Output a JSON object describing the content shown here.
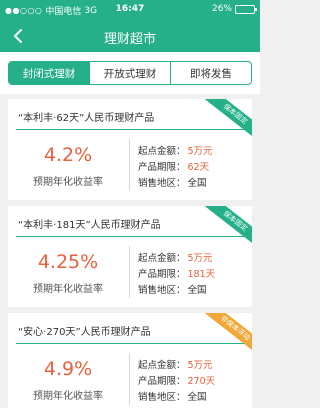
{
  "status_bar": {
    "signal": "●●○○○",
    "carrier": "中国电信",
    "network": "3G",
    "time": "16:47",
    "battery_percent": "26%",
    "battery_level": 0.26
  },
  "nav": {
    "title": "理财超市"
  },
  "tabs": [
    {
      "label": "封闭式理财",
      "active": true
    },
    {
      "label": "开放式理财",
      "active": false
    },
    {
      "label": "即将发售",
      "active": false
    }
  ],
  "products": [
    {
      "title": "“本利丰·62天”人民币理财产品",
      "ribbon": "保本固定",
      "ribbon_color": "#25b089",
      "rate": "4.2%",
      "rate_label": "预期年化收益率",
      "min_amount_label": "起点金额：",
      "min_amount": "5万元",
      "term_label": "产品期限：",
      "term": "62天",
      "region_label": "销售地区：",
      "region": "全国"
    },
    {
      "title": "“本利丰·181天”人民币理财产品",
      "ribbon": "保本固定",
      "ribbon_color": "#25b089",
      "rate": "4.25%",
      "rate_label": "预期年化收益率",
      "min_amount_label": "起点金额：",
      "min_amount": "5万元",
      "term_label": "产品期限：",
      "term": "181天",
      "region_label": "销售地区：",
      "region": "全国"
    },
    {
      "title": "“安心·270天”人民币理财产品",
      "ribbon": "非保本浮动",
      "ribbon_color": "#f0a83a",
      "rate": "4.9%",
      "rate_label": "预期年化收益率",
      "min_amount_label": "起点金额：",
      "min_amount": "5万元",
      "term_label": "产品期限：",
      "term": "270天",
      "region_label": "销售地区：",
      "region": "全国"
    }
  ]
}
